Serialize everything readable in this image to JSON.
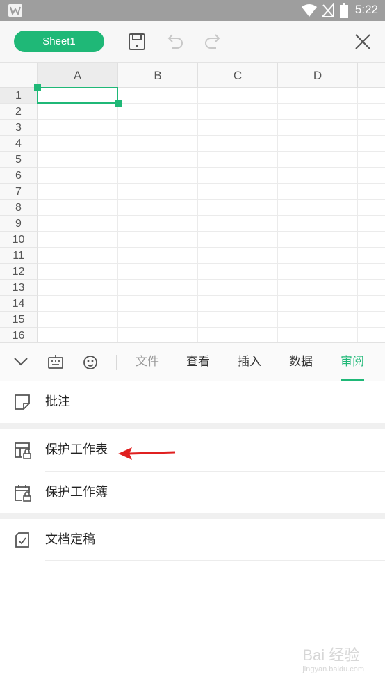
{
  "status_bar": {
    "time": "5:22",
    "icons": [
      "wps-app-icon",
      "wifi-icon",
      "no-signal-icon",
      "battery-icon"
    ]
  },
  "toolbar": {
    "sheet_label": "Sheet1",
    "icons": [
      "save-icon",
      "undo-icon",
      "redo-icon",
      "close-icon"
    ]
  },
  "spreadsheet": {
    "columns": [
      "A",
      "B",
      "C",
      "D"
    ],
    "rows": [
      "1",
      "2",
      "3",
      "4",
      "5",
      "6",
      "7",
      "8",
      "9",
      "10",
      "11",
      "12",
      "13",
      "14",
      "15",
      "16"
    ],
    "selected_cell": "A1"
  },
  "tabbar": {
    "icons": [
      "collapse-chevron-icon",
      "keyboard-icon",
      "emoji-icon"
    ],
    "tabs": [
      {
        "label": "文件",
        "state": "disabled"
      },
      {
        "label": "查看",
        "state": "normal"
      },
      {
        "label": "插入",
        "state": "normal"
      },
      {
        "label": "数据",
        "state": "normal"
      },
      {
        "label": "审阅",
        "state": "active"
      }
    ]
  },
  "menu": {
    "items": [
      {
        "label": "批注",
        "icon": "comment-icon"
      },
      {
        "label": "保护工作表",
        "icon": "protect-sheet-icon"
      },
      {
        "label": "保护工作簿",
        "icon": "protect-workbook-icon"
      },
      {
        "label": "文档定稿",
        "icon": "finalize-document-icon"
      }
    ]
  },
  "colors": {
    "accent": "#1fb877",
    "arrow": "#e02020",
    "status_bar": "#9e9e9e"
  },
  "watermark": {
    "text": "Bai 经验",
    "sub": "jingyan.baidu.com"
  }
}
